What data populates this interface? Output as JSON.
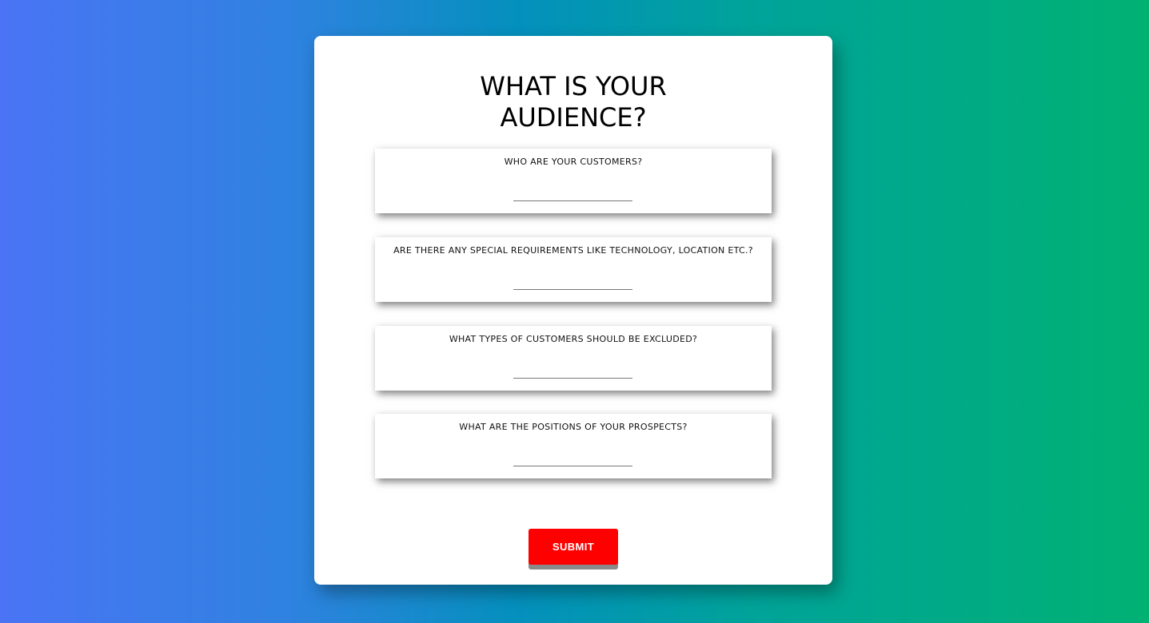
{
  "form": {
    "title": "WHAT IS YOUR AUDIENCE?",
    "questions": [
      {
        "label": "WHO ARE YOUR CUSTOMERS?",
        "value": "",
        "placeholder": ""
      },
      {
        "label": "ARE THERE ANY SPECIAL REQUIREMENTS LIKE TECHNOLOGY, LOCATION ETC.?",
        "value": "",
        "placeholder": ""
      },
      {
        "label": "WHAT TYPES OF CUSTOMERS SHOULD BE EXCLUDED?",
        "value": "",
        "placeholder": ""
      },
      {
        "label": "WHAT ARE THE POSITIONS OF YOUR PROSPECTS?",
        "value": "",
        "placeholder": ""
      }
    ],
    "submit_label": "SUBMIT"
  },
  "colors": {
    "gradient_start": "#4a74f5",
    "gradient_end": "#00b173",
    "submit_bg": "#ff0000",
    "card_bg": "#ffffff"
  }
}
